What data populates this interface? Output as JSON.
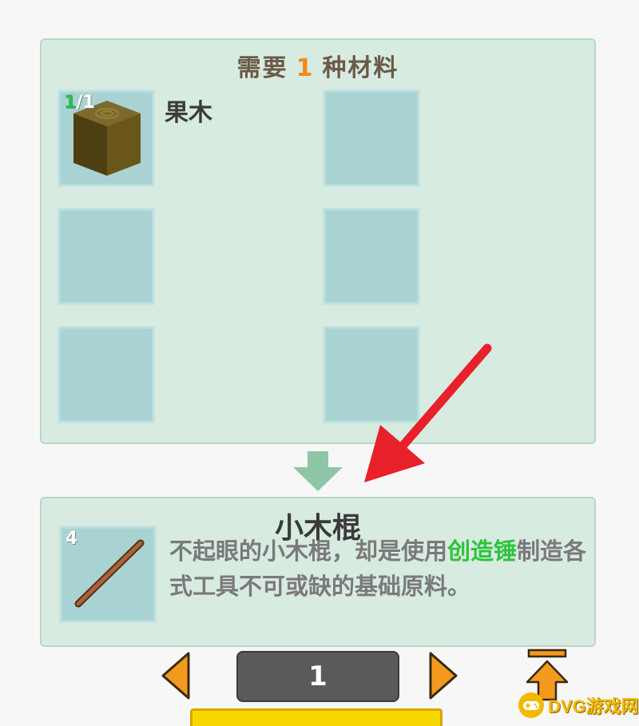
{
  "materials": {
    "header_prefix": "需要",
    "count": "1",
    "header_suffix": "种材料",
    "items": [
      {
        "name": "果木",
        "have": "1",
        "sep": "/",
        "need": "1",
        "icon": "fruitwood-block-icon"
      }
    ]
  },
  "result": {
    "title": "小木棍",
    "count": "4",
    "icon": "wooden-stick-icon",
    "desc_part1": "不起眼的小木棍，却是使用",
    "desc_highlight": "创造锤",
    "desc_part2": "制造各式工具不可或缺的基础原料。"
  },
  "pager": {
    "page": "1",
    "prev_icon": "triangle-left-icon",
    "next_icon": "triangle-right-icon",
    "top_icon": "arrow-up-to-top-icon"
  },
  "watermark": {
    "text": "DVG游戏网",
    "logo_icon": "gamepad-logo-icon"
  },
  "colors": {
    "panel_bg": "#d8ebe1",
    "slot_bg": "#a9d3d3",
    "accent_orange": "#f08a1c",
    "highlight_green": "#2cc43c",
    "arrow_red": "#e8202a"
  }
}
